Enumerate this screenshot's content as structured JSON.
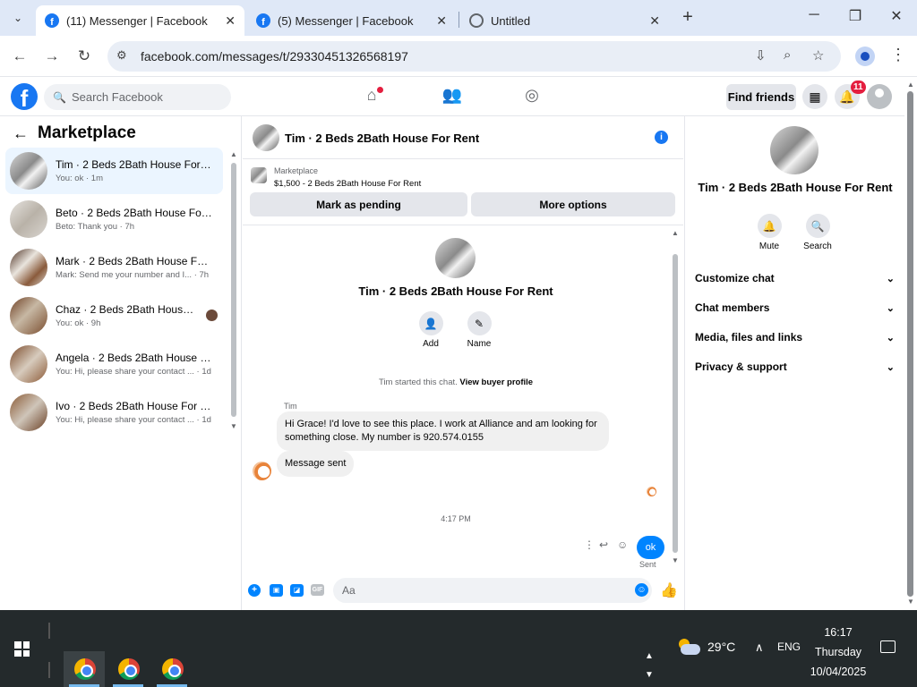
{
  "browser": {
    "tabs": [
      {
        "title": "(11) Messenger | Facebook",
        "active": true
      },
      {
        "title": "(5) Messenger | Facebook",
        "active": false
      },
      {
        "title": "Untitled",
        "active": false
      }
    ],
    "new_tab": "+",
    "window_controls": {
      "minimize": "─",
      "maximize": "❐",
      "close": "✕"
    },
    "url": "facebook.com/messages/t/29330451326568197"
  },
  "fb_header": {
    "logo": "f",
    "search_placeholder": "Search Facebook",
    "find_friends": "Find friends",
    "notifications_count": "11"
  },
  "left_panel": {
    "title": "Marketplace",
    "conversations": [
      {
        "name": "Tim · 2 Beds 2Bath House For Rent",
        "preview": "You: ok · 1m",
        "active": true
      },
      {
        "name": "Beto · 2 Beds 2Bath House For Rent",
        "preview": "Beto: Thank you · 7h"
      },
      {
        "name": "Mark · 2 Beds 2Bath House For Rent",
        "preview": "Mark: Send me your number and I... · 7h"
      },
      {
        "name": "Chaz · 2 Beds 2Bath House For Rent",
        "preview": "You: ok · 9h"
      },
      {
        "name": "Angela · 2 Beds 2Bath House For Rent",
        "preview": "You: Hi, please share your contact ... · 1d"
      },
      {
        "name": "Ivo · 2 Beds 2Bath House For Rent",
        "preview": "You: Hi, please share your contact ... · 1d"
      }
    ]
  },
  "chat": {
    "title": "Tim · 2 Beds 2Bath House For Rent",
    "marketplace_label": "Marketplace",
    "listing": "$1,500 - 2 Beds 2Bath House For Rent",
    "mark_pending": "Mark as pending",
    "more_options": "More options",
    "intro_name": "Tim · 2 Beds 2Bath House For Rent",
    "action_add": "Add",
    "action_name": "Name",
    "started_text": "Tim started this chat.",
    "view_profile": "View buyer profile",
    "sender": "Tim",
    "message_1": "Hi Grace!  I'd love to see this place. I work at Alliance and am looking for something close. My number is 920.574.0155",
    "message_2": "Message sent",
    "timestamp": "4:17 PM",
    "outgoing": "ok",
    "sent_status": "Sent",
    "composer_placeholder": "Aa",
    "gif": "GIF"
  },
  "right_panel": {
    "name": "Tim · 2 Beds 2Bath House For Rent",
    "mute": "Mute",
    "search": "Search",
    "sections": [
      "Customize chat",
      "Chat members",
      "Media, files and links",
      "Privacy & support"
    ]
  },
  "taskbar": {
    "temperature": "29°C",
    "language": "ENG",
    "time": "16:17",
    "day": "Thursday",
    "date": "10/04/2025"
  }
}
